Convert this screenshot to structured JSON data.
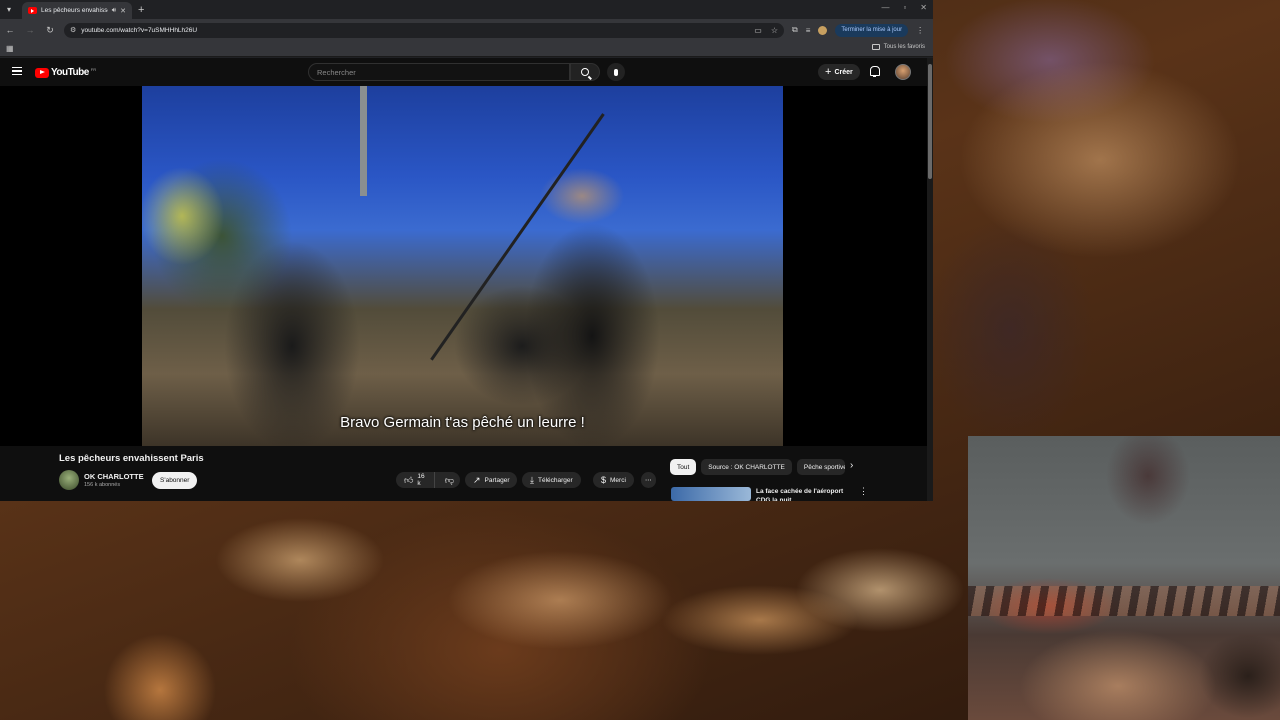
{
  "browser": {
    "tab_title": "Les pêcheurs envahissent P",
    "url": "youtube.com/watch?v=7uSMHHhLh26U",
    "update_button": "Terminer la mise à jour",
    "all_favorites": "Tous les favoris"
  },
  "youtube": {
    "logo_text": "YouTube",
    "logo_country": "FR",
    "search_placeholder": "Rechercher",
    "create_label": "Créer",
    "video": {
      "subtitle": "Bravo Germain t'as pêché un leurre !",
      "title": "Les pêcheurs envahissent Paris",
      "channel_name": "OK CHARLOTTE",
      "subscribers": "156 k abonnés",
      "subscribe_label": "S'abonner",
      "likes": "16 k",
      "share_label": "Partager",
      "download_label": "Télécharger",
      "thanks_label": "Merci"
    },
    "chips": [
      "Tout",
      "Source : OK CHARLOTTE",
      "Pêche sportive"
    ],
    "recommendation": {
      "title": "La face cachée de l'aéroport CDG la nuit"
    }
  },
  "colors": {
    "youtube_red": "#ff0000",
    "page_bg": "#0f0f0f",
    "chrome_bg": "#202124"
  }
}
